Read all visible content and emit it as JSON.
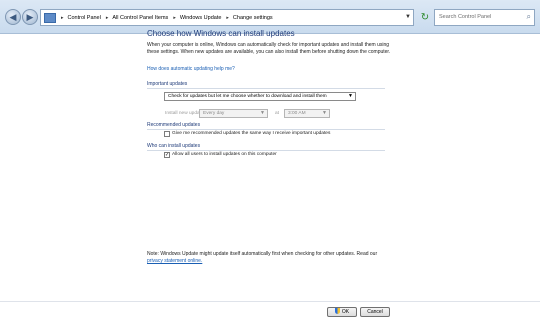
{
  "address_bar": {
    "crumbs": [
      "Control Panel",
      "All Control Panel Items",
      "Windows Update",
      "Change settings"
    ],
    "search_placeholder": "Search Control Panel"
  },
  "main": {
    "title": "Choose how Windows can install updates",
    "intro": "When your computer is online, Windows can automatically check for important updates and install them using these settings. When new updates are available, you can also install them before shutting down the computer.",
    "help_link": "How does automatic updating help me?",
    "important_updates": {
      "heading": "Important updates",
      "selected_option": "Check for updates but let me choose whether to download and install them",
      "install_label": "Install new updates:",
      "day_value": "Every day",
      "at_label": "at",
      "time_value": "3:00 AM"
    },
    "recommended_updates": {
      "heading": "Recommended updates",
      "checkbox_label": "Give me recommended updates the same way I receive important updates",
      "checked": false
    },
    "who_can_install": {
      "heading": "Who can install updates",
      "checkbox_label": "Allow all users to install updates on this computer",
      "checked": true
    },
    "note_text": "Note: Windows Update might update itself automatically first when checking for other updates.  Read our",
    "note_link": "privacy statement online."
  },
  "footer": {
    "ok_label": "OK",
    "cancel_label": "Cancel"
  }
}
